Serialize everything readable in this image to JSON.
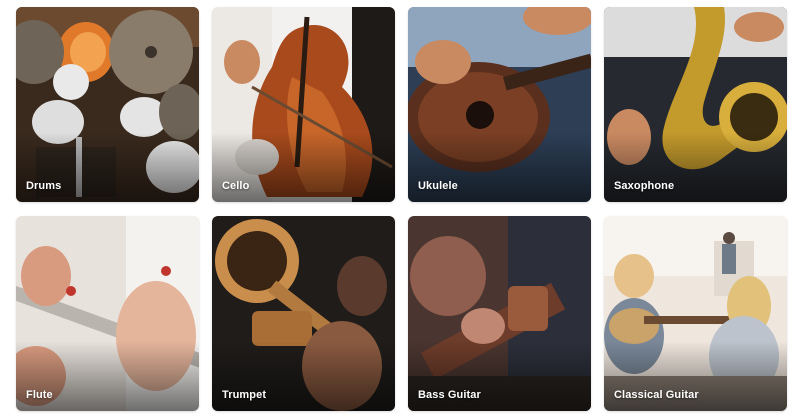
{
  "instruments": [
    {
      "label": "Drums",
      "icon": "drum-kit-photo"
    },
    {
      "label": "Cello",
      "icon": "cello-photo"
    },
    {
      "label": "Ukulele",
      "icon": "ukulele-photo"
    },
    {
      "label": "Saxophone",
      "icon": "saxophone-photo"
    },
    {
      "label": "Flute",
      "icon": "flute-photo"
    },
    {
      "label": "Trumpet",
      "icon": "trumpet-photo"
    },
    {
      "label": "Bass Guitar",
      "icon": "bass-guitar-photo"
    },
    {
      "label": "Classical Guitar",
      "icon": "classical-guitar-photo"
    }
  ]
}
